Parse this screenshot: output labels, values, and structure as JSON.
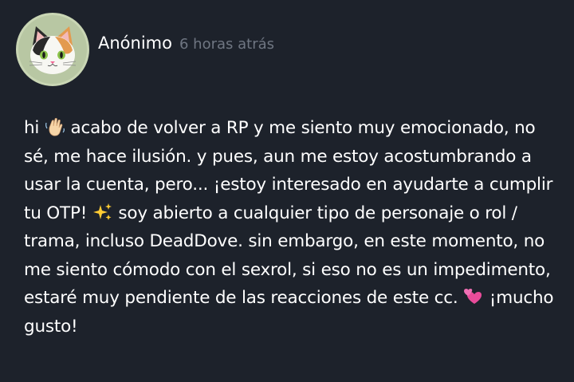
{
  "post": {
    "author": "Anónimo",
    "time": "6 horas atrás",
    "avatar_icon": "calico-cat-icon",
    "message_lines": [
      [
        "hi",
        "waving-hand-emoji",
        "acabo de volver a RP y me siento muy emocionado, no"
      ],
      [
        "sé, me hace ilusión. y pues, aun me estoy acostumbrando a"
      ],
      [
        "usar la cuenta, pero... ¡estoy interesado en ayudarte a cumplir"
      ],
      [
        "tu OTP!",
        "sparkles-emoji",
        "soy abierto a cualquier tipo de personaje o rol /"
      ],
      [
        "trama, incluso DeadDove. sin embargo, en este momento, no"
      ],
      [
        "me siento cómodo con el sexrol, si eso no es un impedimento,"
      ],
      [
        "estaré muy pendiente de las reacciones de este cc.",
        "two-hearts-emoji",
        "¡mucho"
      ],
      [
        "gusto!"
      ]
    ]
  },
  "colors": {
    "background": "#1d222b",
    "text": "#ffffff",
    "muted": "#6f7682",
    "avatar_ring": "#c9d6b4"
  }
}
